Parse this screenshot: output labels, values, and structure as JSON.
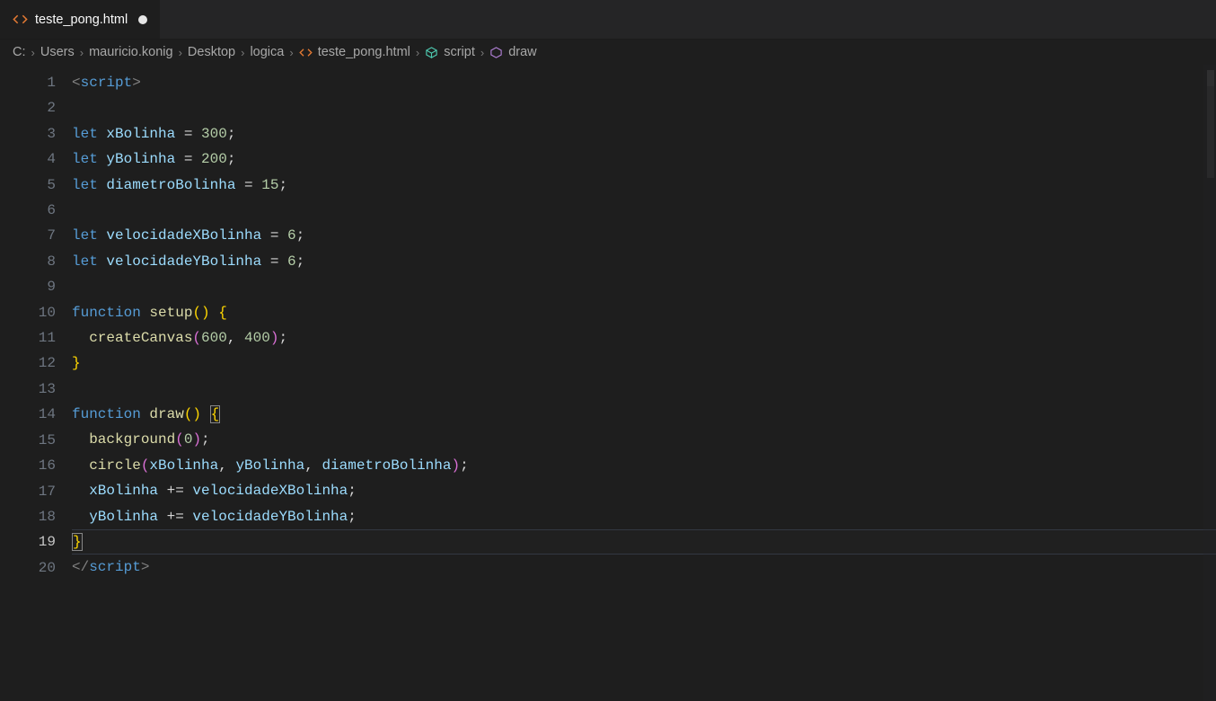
{
  "tab": {
    "filename": "teste_pong.html",
    "modified": true
  },
  "breadcrumbs": {
    "segments": [
      "C:",
      "Users",
      "mauricio.konig",
      "Desktop",
      "logica"
    ],
    "file": "teste_pong.html",
    "symbol1": "script",
    "symbol2": "draw"
  },
  "editor": {
    "active_line": 19,
    "line_count": 20,
    "tokens": {
      "l1": [
        [
          "pnc",
          "<"
        ],
        [
          "tag",
          "script"
        ],
        [
          "pnc",
          ">"
        ]
      ],
      "l2": [
        [
          "",
          ""
        ]
      ],
      "l3": [
        [
          "kw",
          "let "
        ],
        [
          "var",
          "xBolinha"
        ],
        [
          "op",
          " = "
        ],
        [
          "num",
          "300"
        ],
        [
          "sem",
          ";"
        ]
      ],
      "l4": [
        [
          "kw",
          "let "
        ],
        [
          "var",
          "yBolinha"
        ],
        [
          "op",
          " = "
        ],
        [
          "num",
          "200"
        ],
        [
          "sem",
          ";"
        ]
      ],
      "l5": [
        [
          "kw",
          "let "
        ],
        [
          "var",
          "diametroBolinha"
        ],
        [
          "op",
          " = "
        ],
        [
          "num",
          "15"
        ],
        [
          "sem",
          ";"
        ]
      ],
      "l6": [
        [
          "",
          ""
        ]
      ],
      "l7": [
        [
          "kw",
          "let "
        ],
        [
          "var",
          "velocidadeXBolinha"
        ],
        [
          "op",
          " = "
        ],
        [
          "num",
          "6"
        ],
        [
          "sem",
          ";"
        ]
      ],
      "l8": [
        [
          "kw",
          "let "
        ],
        [
          "var",
          "velocidadeYBolinha"
        ],
        [
          "op",
          " = "
        ],
        [
          "num",
          "6"
        ],
        [
          "sem",
          ";"
        ]
      ],
      "l9": [
        [
          "",
          ""
        ]
      ],
      "l10": [
        [
          "kw",
          "function "
        ],
        [
          "fn",
          "setup"
        ],
        [
          "brY",
          "()"
        ],
        [
          "op",
          " "
        ],
        [
          "brY",
          "{"
        ]
      ],
      "l11": [
        [
          "op",
          "  "
        ],
        [
          "fn",
          "createCanvas"
        ],
        [
          "brP",
          "("
        ],
        [
          "num",
          "600"
        ],
        [
          "op",
          ", "
        ],
        [
          "num",
          "400"
        ],
        [
          "brP",
          ")"
        ],
        [
          "sem",
          ";"
        ]
      ],
      "l12": [
        [
          "brY",
          "}"
        ]
      ],
      "l13": [
        [
          "",
          ""
        ]
      ],
      "l14": [
        [
          "kw",
          "function "
        ],
        [
          "fn",
          "draw"
        ],
        [
          "brY",
          "()"
        ],
        [
          "op",
          " "
        ],
        [
          "brYm",
          "{"
        ]
      ],
      "l15": [
        [
          "op",
          "  "
        ],
        [
          "fn",
          "background"
        ],
        [
          "brP",
          "("
        ],
        [
          "num",
          "0"
        ],
        [
          "brP",
          ")"
        ],
        [
          "sem",
          ";"
        ]
      ],
      "l16": [
        [
          "op",
          "  "
        ],
        [
          "fn",
          "circle"
        ],
        [
          "brP",
          "("
        ],
        [
          "var",
          "xBolinha"
        ],
        [
          "op",
          ", "
        ],
        [
          "var",
          "yBolinha"
        ],
        [
          "op",
          ", "
        ],
        [
          "var",
          "diametroBolinha"
        ],
        [
          "brP",
          ")"
        ],
        [
          "sem",
          ";"
        ]
      ],
      "l17": [
        [
          "op",
          "  "
        ],
        [
          "var",
          "xBolinha"
        ],
        [
          "op",
          " += "
        ],
        [
          "var",
          "velocidadeXBolinha"
        ],
        [
          "sem",
          ";"
        ]
      ],
      "l18": [
        [
          "op",
          "  "
        ],
        [
          "var",
          "yBolinha"
        ],
        [
          "op",
          " += "
        ],
        [
          "var",
          "velocidadeYBolinha"
        ],
        [
          "sem",
          ";"
        ]
      ],
      "l19": [
        [
          "brYm",
          "}"
        ]
      ],
      "l20": [
        [
          "pnc",
          "</"
        ],
        [
          "tag",
          "script"
        ],
        [
          "pnc",
          ">"
        ]
      ]
    }
  }
}
